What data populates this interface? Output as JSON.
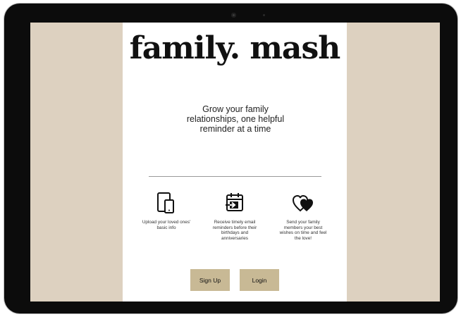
{
  "site": {
    "logo": "family. mash",
    "tagline": "Grow your family relationships, one helpful reminder at a time"
  },
  "features": [
    {
      "icon": "devices-icon",
      "text": "Upload your loved ones' basic info"
    },
    {
      "icon": "calendar-import-icon",
      "text": "Receive timely email reminders before their birthdays and anniversaries"
    },
    {
      "icon": "hearts-icon",
      "text": "Send your family members your best wishes on time and feel the love!"
    }
  ],
  "buttons": {
    "signup_label": "Sign Up",
    "login_label": "Login"
  },
  "colors": {
    "background": "#ddd1c0",
    "panel": "#ffffff",
    "button": "#c8b995",
    "device_frame": "#0c0c0c"
  }
}
